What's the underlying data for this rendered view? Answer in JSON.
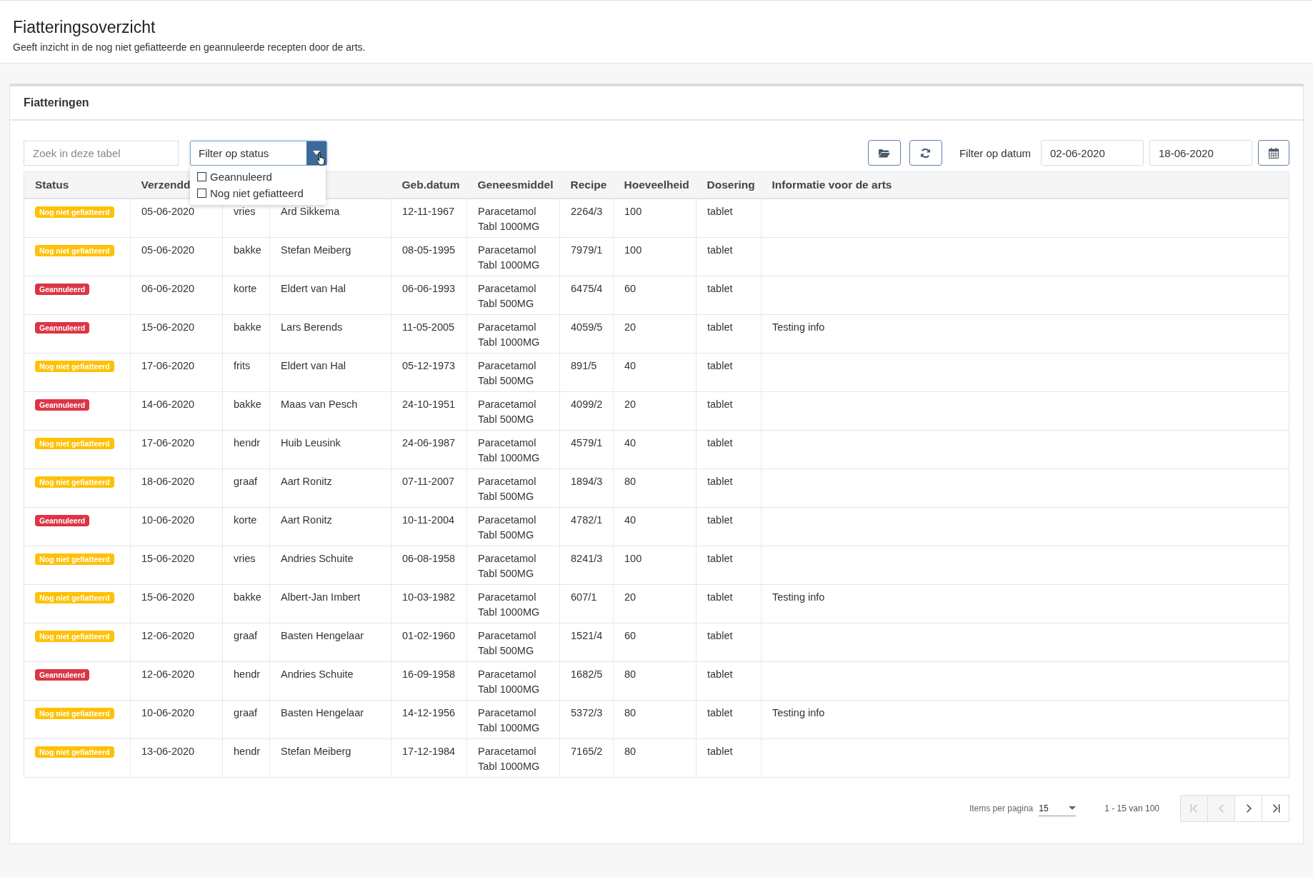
{
  "page": {
    "title": "Fiatteringsoverzicht",
    "subtitle": "Geeft inzicht in de nog niet gefiatteerde en geannuleerde recepten door de arts."
  },
  "card": {
    "title": "Fiatteringen"
  },
  "search": {
    "placeholder": "Zoek in deze tabel"
  },
  "status_filter": {
    "label": "Filter op status",
    "expanded": true,
    "options": [
      {
        "label": "Geannuleerd",
        "checked": false
      },
      {
        "label": "Nog niet gefiatteerd",
        "checked": false
      }
    ]
  },
  "date_filter": {
    "label": "Filter op datum",
    "from": "02-06-2020",
    "to": "18-06-2020"
  },
  "table": {
    "columns": [
      "Status",
      "Verzendd",
      "",
      "",
      "Geb.datum",
      "Geneesmiddel",
      "Recipe",
      "Hoeveelheid",
      "Dosering",
      "Informatie voor de arts"
    ],
    "rows": [
      {
        "kind": "pending",
        "cells": [
          "Nog niet gefiatteerd",
          "05-06-2020",
          "vries",
          "Ard Sikkema",
          "12-11-1967",
          "Paracetamol\nTabl 1000MG",
          "2264/3",
          "100",
          "tablet"
        ]
      },
      {
        "kind": "pending",
        "cells": [
          "Nog niet gefiatteerd",
          "05-06-2020",
          "bakke",
          "Stefan Meiberg",
          "08-05-1995",
          "Paracetamol\nTabl 1000MG",
          "7979/1",
          "100",
          "tablet"
        ]
      },
      {
        "kind": "cancelled",
        "cells": [
          "Geannuleerd",
          "06-06-2020",
          "korte",
          "Eldert van Hal",
          "06-06-1993",
          "Paracetamol\nTabl 500MG",
          "6475/4",
          "60",
          "tablet"
        ]
      },
      {
        "kind": "cancelled",
        "cells": [
          "Geannuleerd",
          "15-06-2020",
          "bakke",
          "Lars Berends",
          "11-05-2005",
          "Paracetamol\nTabl 1000MG",
          "4059/5",
          "20",
          "tablet",
          "Testing info"
        ]
      },
      {
        "kind": "pending",
        "cells": [
          "Nog niet gefiatteerd",
          "17-06-2020",
          "frits",
          "Eldert van Hal",
          "05-12-1973",
          "Paracetamol\nTabl 500MG",
          "891/5",
          "40",
          "tablet"
        ]
      },
      {
        "kind": "cancelled",
        "cells": [
          "Geannuleerd",
          "14-06-2020",
          "bakke",
          "Maas van Pesch",
          "24-10-1951",
          "Paracetamol\nTabl 500MG",
          "4099/2",
          "20",
          "tablet"
        ]
      },
      {
        "kind": "pending",
        "cells": [
          "Nog niet gefiatteerd",
          "17-06-2020",
          "hendr",
          "Huib Leusink",
          "24-06-1987",
          "Paracetamol\nTabl 1000MG",
          "4579/1",
          "40",
          "tablet"
        ]
      },
      {
        "kind": "pending",
        "cells": [
          "Nog niet gefiatteerd",
          "18-06-2020",
          "graaf",
          "Aart Ronitz",
          "07-11-2007",
          "Paracetamol\nTabl 500MG",
          "1894/3",
          "80",
          "tablet"
        ]
      },
      {
        "kind": "cancelled",
        "cells": [
          "Geannuleerd",
          "10-06-2020",
          "korte",
          "Aart Ronitz",
          "10-11-2004",
          "Paracetamol\nTabl 500MG",
          "4782/1",
          "40",
          "tablet"
        ]
      },
      {
        "kind": "pending",
        "cells": [
          "Nog niet gefiatteerd",
          "15-06-2020",
          "vries",
          "Andries Schuite",
          "06-08-1958",
          "Paracetamol\nTabl 500MG",
          "8241/3",
          "100",
          "tablet"
        ]
      },
      {
        "kind": "pending",
        "cells": [
          "Nog niet gefiatteerd",
          "15-06-2020",
          "bakke",
          "Albert-Jan Imbert",
          "10-03-1982",
          "Paracetamol\nTabl 1000MG",
          "607/1",
          "20",
          "tablet",
          "Testing info"
        ]
      },
      {
        "kind": "pending",
        "cells": [
          "Nog niet gefiatteerd",
          "12-06-2020",
          "graaf",
          "Basten Hengelaar",
          "01-02-1960",
          "Paracetamol\nTabl 500MG",
          "1521/4",
          "60",
          "tablet"
        ]
      },
      {
        "kind": "cancelled",
        "cells": [
          "Geannuleerd",
          "12-06-2020",
          "hendr",
          "Andries Schuite",
          "16-09-1958",
          "Paracetamol\nTabl 1000MG",
          "1682/5",
          "80",
          "tablet"
        ]
      },
      {
        "kind": "pending",
        "cells": [
          "Nog niet gefiatteerd",
          "10-06-2020",
          "graaf",
          "Basten Hengelaar",
          "14-12-1956",
          "Paracetamol\nTabl 1000MG",
          "5372/3",
          "80",
          "tablet",
          "Testing info"
        ]
      },
      {
        "kind": "pending",
        "cells": [
          "Nog niet gefiatteerd",
          "13-06-2020",
          "hendr",
          "Stefan Meiberg",
          "17-12-1984",
          "Paracetamol\nTabl 1000MG",
          "7165/2",
          "80",
          "tablet"
        ]
      }
    ]
  },
  "pagination": {
    "per_page_label": "Items per pagina",
    "per_page": "15",
    "range": "1 - 15 van 100",
    "buttons": [
      {
        "kind": "first",
        "disabled": true
      },
      {
        "kind": "prev",
        "disabled": true
      },
      {
        "kind": "next",
        "disabled": false
      },
      {
        "kind": "last",
        "disabled": false
      }
    ]
  }
}
